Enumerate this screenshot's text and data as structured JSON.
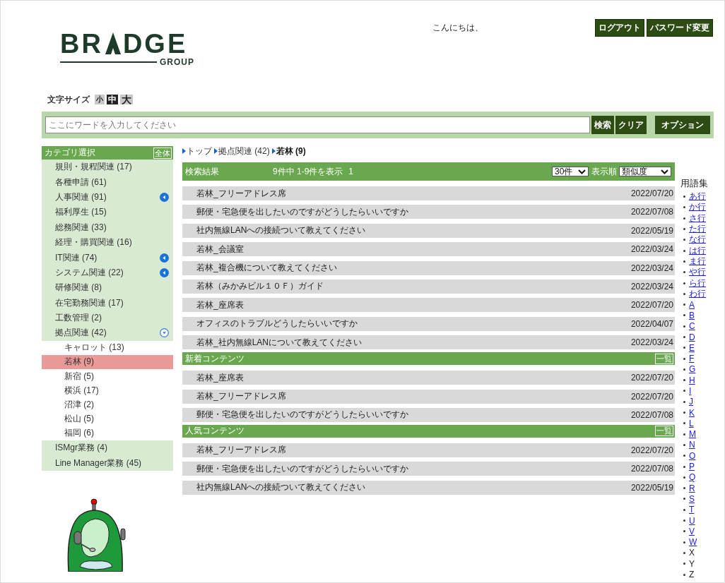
{
  "logo": {
    "parts": [
      "BR",
      "DGE"
    ],
    "subtitle": "GROUP"
  },
  "header": {
    "greeting": "こんにちは、",
    "buttons": [
      "ログアウト",
      "パスワード変更"
    ]
  },
  "font_size": {
    "label": "文字サイズ",
    "options": [
      {
        "label": "小",
        "selected": false
      },
      {
        "label": "中",
        "selected": true
      },
      {
        "label": "大",
        "selected": false
      }
    ]
  },
  "search": {
    "placeholder": "ここにワードを入力してください",
    "buttons": [
      "検索",
      "クリア"
    ],
    "option_button": "オプション"
  },
  "sidebar": {
    "title": "カテゴリ選択",
    "all_button": "全体",
    "items": [
      {
        "label": "規則・規程関連 (17)",
        "selected": false
      },
      {
        "label": "各種申請 (61)",
        "selected": false
      },
      {
        "label": "人事関連 (91)",
        "selected": false,
        "expanded": false
      },
      {
        "label": "福利厚生 (15)",
        "selected": false
      },
      {
        "label": "総務関連 (33)",
        "selected": false
      },
      {
        "label": "経理・購買関連 (16)",
        "selected": false
      },
      {
        "label": "IT関連 (74)",
        "selected": false,
        "expanded": false
      },
      {
        "label": "システム関連 (22)",
        "selected": false,
        "expanded": false
      },
      {
        "label": "研修関連 (8)",
        "selected": false
      },
      {
        "label": "在宅勤務関連 (17)",
        "selected": false
      },
      {
        "label": "工数管理 (2)",
        "selected": false
      },
      {
        "label": "拠点関連 (42)",
        "selected": false,
        "expanded": true,
        "children": [
          {
            "label": "キャロット (13)",
            "selected": false
          },
          {
            "label": "若林 (9)",
            "selected": true
          },
          {
            "label": "新宿 (5)",
            "selected": false
          },
          {
            "label": "横浜 (17)",
            "selected": false
          },
          {
            "label": "沼津 (2)",
            "selected": false
          },
          {
            "label": "松山 (5)",
            "selected": false
          },
          {
            "label": "福岡 (6)",
            "selected": false
          }
        ]
      },
      {
        "label": "ISMgr業務 (4)",
        "selected": false
      },
      {
        "label": "Line Manager業務 (45)",
        "selected": false
      }
    ]
  },
  "breadcrumb": [
    {
      "label": "トップ",
      "current": false
    },
    {
      "label": "拠点関連 (42)",
      "current": false
    },
    {
      "label": "若林 (9)",
      "current": true
    }
  ],
  "results": {
    "title": "検索結果",
    "summary": "9件中 1-9件を表示",
    "page": "1",
    "per_page": "30件",
    "sort_label": "表示順",
    "sort": "類似度",
    "rows": [
      {
        "title": "若林_フリーアドレス席",
        "date": "2022/07/20"
      },
      {
        "title": "郵便・宅急便を出したいのですがどうしたらいいですか",
        "date": "2022/07/08"
      },
      {
        "title": "社内無線LANへの接続ついて教えてください",
        "date": "2022/05/19"
      },
      {
        "title": "若林_会議室",
        "date": "2022/03/24"
      },
      {
        "title": "若林_複合機について教えてください",
        "date": "2022/03/24"
      },
      {
        "title": "若林（みかみビル１０Ｆ）ガイド",
        "date": "2022/03/24"
      },
      {
        "title": "若林_座席表",
        "date": "2022/07/20"
      },
      {
        "title": "オフィスのトラブルどうしたらいいですか",
        "date": "2022/04/07"
      },
      {
        "title": "若林_社内無線LANについて教えてください",
        "date": "2022/03/24"
      }
    ]
  },
  "sections": [
    {
      "title": "新着コンテンツ",
      "more": "一覧",
      "rows": [
        {
          "title": "若林_座席表",
          "date": "2022/07/20"
        },
        {
          "title": "若林_フリーアドレス席",
          "date": "2022/07/20"
        },
        {
          "title": "郵便・宅急便を出したいのですがどうしたらいいですか",
          "date": "2022/07/08"
        }
      ]
    },
    {
      "title": "人気コンテンツ",
      "more": "一覧",
      "rows": [
        {
          "title": "若林_フリーアドレス席",
          "date": "2022/07/20"
        },
        {
          "title": "郵便・宅急便を出したいのですがどうしたらいいですか",
          "date": "2022/07/08"
        },
        {
          "title": "社内無線LANへの接続ついて教えてください",
          "date": "2022/05/19"
        }
      ]
    }
  ],
  "glossary": {
    "title": "用語集",
    "items": [
      {
        "label": "あ行",
        "link": true
      },
      {
        "label": "か行",
        "link": true
      },
      {
        "label": "さ行",
        "link": true
      },
      {
        "label": "た行",
        "link": true
      },
      {
        "label": "な行",
        "link": true
      },
      {
        "label": "は行",
        "link": true
      },
      {
        "label": "ま行",
        "link": true
      },
      {
        "label": "や行",
        "link": true
      },
      {
        "label": "ら行",
        "link": true
      },
      {
        "label": "わ行",
        "link": true
      },
      {
        "label": "A",
        "link": true
      },
      {
        "label": "B",
        "link": true
      },
      {
        "label": "C",
        "link": true
      },
      {
        "label": "D",
        "link": true
      },
      {
        "label": "E",
        "link": true
      },
      {
        "label": "F",
        "link": true
      },
      {
        "label": "G",
        "link": true
      },
      {
        "label": "H",
        "link": true
      },
      {
        "label": "I",
        "link": true
      },
      {
        "label": "J",
        "link": true
      },
      {
        "label": "K",
        "link": true
      },
      {
        "label": "L",
        "link": true
      },
      {
        "label": "M",
        "link": true
      },
      {
        "label": "N",
        "link": true
      },
      {
        "label": "O",
        "link": true
      },
      {
        "label": "P",
        "link": true
      },
      {
        "label": "Q",
        "link": true
      },
      {
        "label": "R",
        "link": true
      },
      {
        "label": "S",
        "link": true
      },
      {
        "label": "T",
        "link": true
      },
      {
        "label": "U",
        "link": true
      },
      {
        "label": "V",
        "link": true
      },
      {
        "label": "W",
        "link": true
      },
      {
        "label": "X",
        "link": false
      },
      {
        "label": "Y",
        "link": false
      },
      {
        "label": "Z",
        "link": false
      }
    ]
  }
}
